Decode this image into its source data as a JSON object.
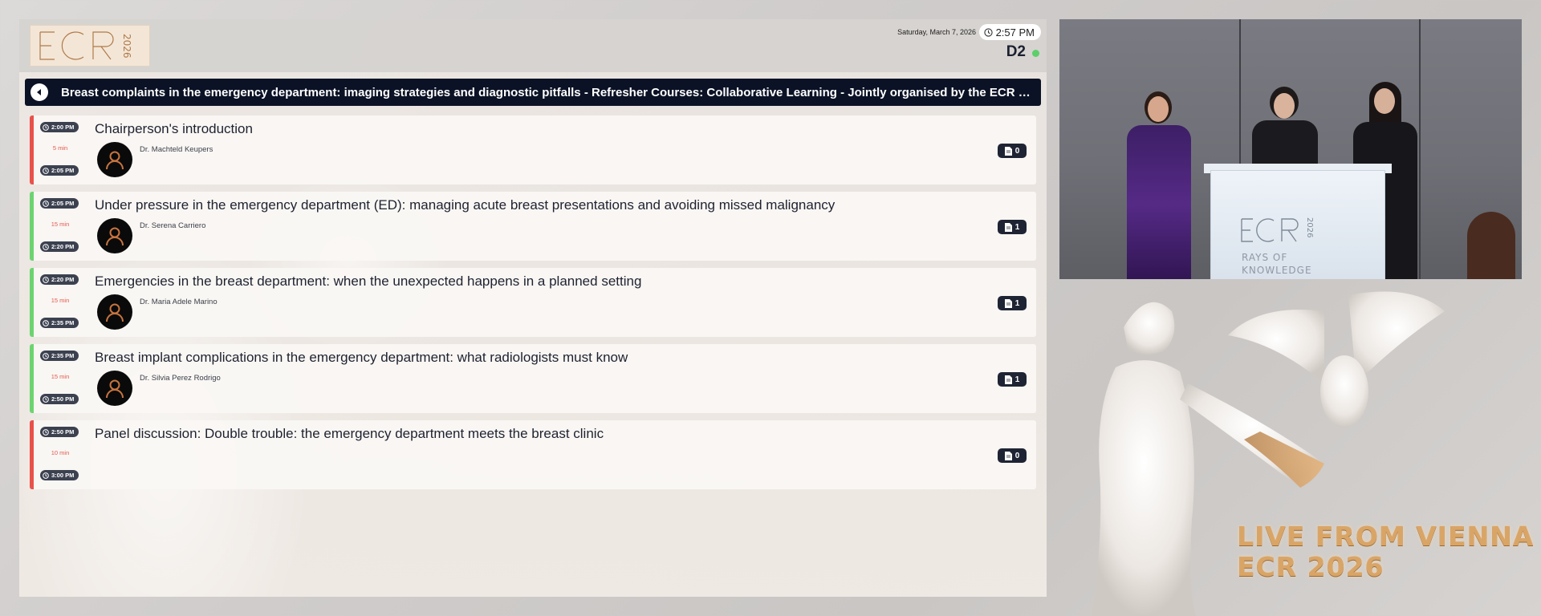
{
  "header": {
    "logo_text": "ECR 2026",
    "date": "Saturday, March 7, 2026",
    "time": "2:57 PM",
    "room": "D2",
    "live_dot_color": "#5ccf6a"
  },
  "session_title": "Breast complaints in the emergency department: imaging strategies and diagnostic pitfalls - Refresher Courses: Collaborative Learning - Jointly organised by the ECR Scientific Subc...",
  "sessions": [
    {
      "start": "2:00 PM",
      "end": "2:05 PM",
      "duration": "5 min",
      "title": "Chairperson's introduction",
      "speaker": "Dr. Machteld Keupers",
      "docs": "0",
      "accent": "#e8524a"
    },
    {
      "start": "2:05 PM",
      "end": "2:20 PM",
      "duration": "15 min",
      "title": "Under pressure in the emergency department (ED): managing acute breast presentations and avoiding missed malignancy",
      "speaker": "Dr. Serena Carriero",
      "docs": "1",
      "accent": "#6cd46f"
    },
    {
      "start": "2:20 PM",
      "end": "2:35 PM",
      "duration": "15 min",
      "title": "Emergencies in the breast department: when the unexpected happens in a planned setting",
      "speaker": "Dr. Maria Adele Marino",
      "docs": "1",
      "accent": "#6cd46f"
    },
    {
      "start": "2:35 PM",
      "end": "2:50 PM",
      "duration": "15 min",
      "title": "Breast implant complications in the emergency department: what radiologists must know",
      "speaker": "Dr. Silvia Perez Rodrigo",
      "docs": "1",
      "accent": "#6cd46f"
    },
    {
      "start": "2:50 PM",
      "end": "3:00 PM",
      "duration": "10 min",
      "title": "Panel discussion: Double trouble: the emergency department meets the breast clinic",
      "speaker": "",
      "docs": "0",
      "accent": "#e8524a"
    }
  ],
  "video": {
    "podium_logo": "ECR 2026",
    "podium_tagline": "RAYS OF KNOWLEDGE"
  },
  "branding": {
    "line1": "LIVE FROM VIENNA",
    "line2": "ECR 2026"
  }
}
